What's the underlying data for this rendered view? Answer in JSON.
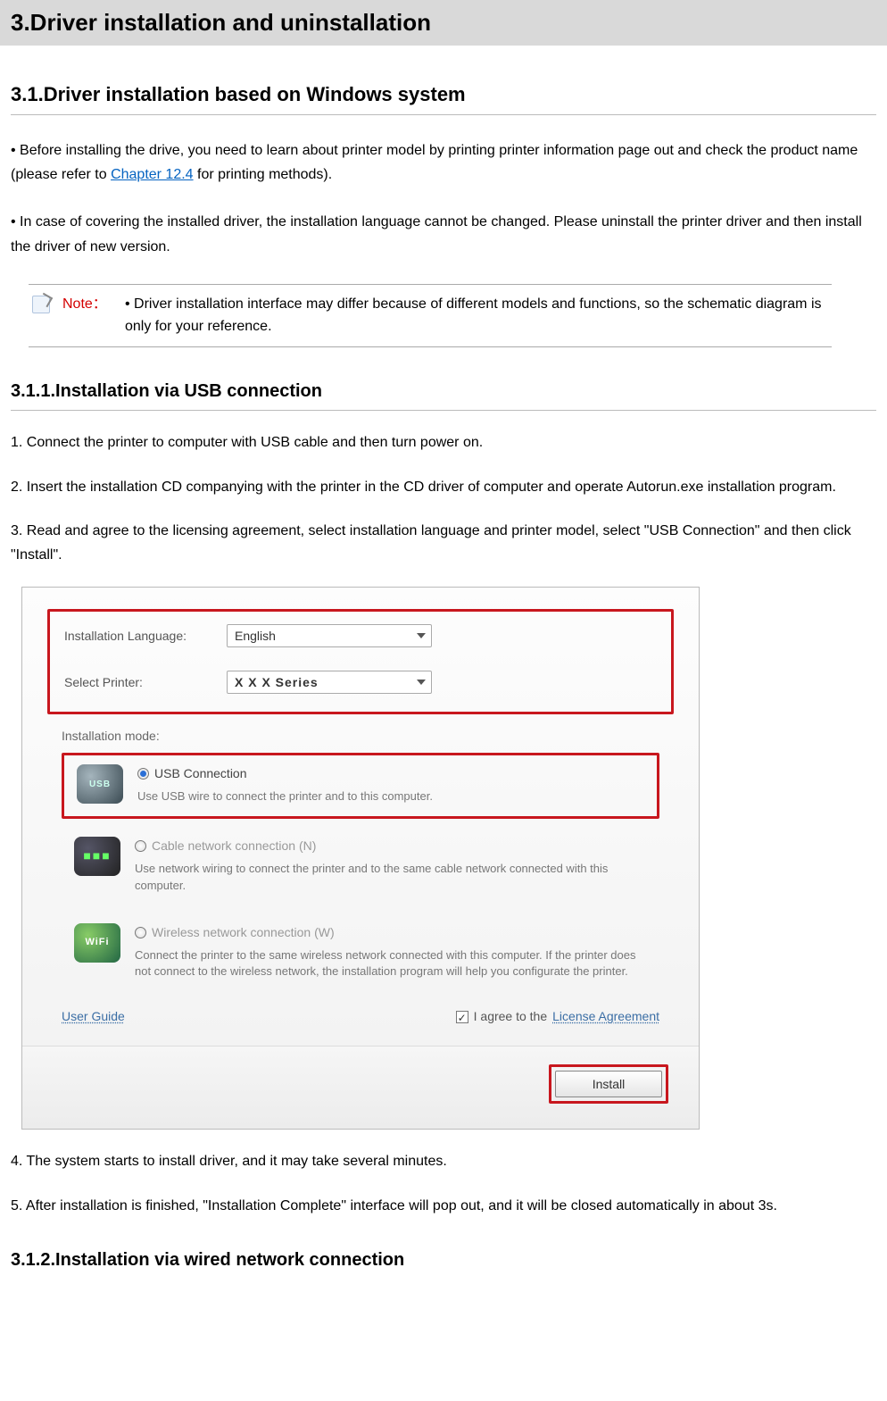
{
  "h1": "3.Driver installation and uninstallation",
  "h2": "3.1.Driver installation based on Windows system",
  "para1a": "• Before installing the drive, you need to learn about printer model by printing printer information page out and check the product name (please refer to ",
  "para1link": "Chapter 12.4",
  "para1b": " for printing methods).",
  "para2": "• In case of covering the installed driver, the installation language cannot be changed. Please uninstall the printer driver and then install the driver of new version.",
  "note_label": "Note：",
  "note_text": "• Driver installation interface may differ because of different models and functions, so the schematic diagram is only for your reference.",
  "h3a": "3.1.1.Installation via USB connection",
  "step1": "1. Connect the printer to computer with USB cable and then turn power on.",
  "step2": "2. Insert the installation CD companying with the printer in the CD driver of computer and operate Autorun.exe installation program.",
  "step3": "3. Read and agree to the licensing agreement, select installation language and printer model, select \"USB Connection\" and then click \"Install\".",
  "installer": {
    "lang_label": "Installation Language:",
    "lang_value": "English",
    "printer_label": "Select Printer:",
    "printer_value": "X X X    Series",
    "mode_label": "Installation mode:",
    "opt1_title": "USB Connection",
    "opt1_desc": "Use USB wire to connect the printer and to this computer.",
    "opt2_title": "Cable network connection (N)",
    "opt2_desc": "Use network wiring to connect the printer and to the same cable network connected with this computer.",
    "opt3_title": "Wireless network connection (W)",
    "opt3_desc": "Connect the printer to the same wireless network connected with this computer. If the printer does not connect to the wireless network, the installation program will help you configurate the printer.",
    "userguide": "User Guide",
    "agree_prefix": "I agree to the ",
    "license": "License Agreement",
    "install_btn": "Install"
  },
  "step4": "4. The system starts to install driver, and it may take several minutes.",
  "step5": "5. After installation is finished, \"Installation Complete\" interface will pop out, and it will be closed automatically in about 3s.",
  "h3b": "3.1.2.Installation via wired network connection"
}
